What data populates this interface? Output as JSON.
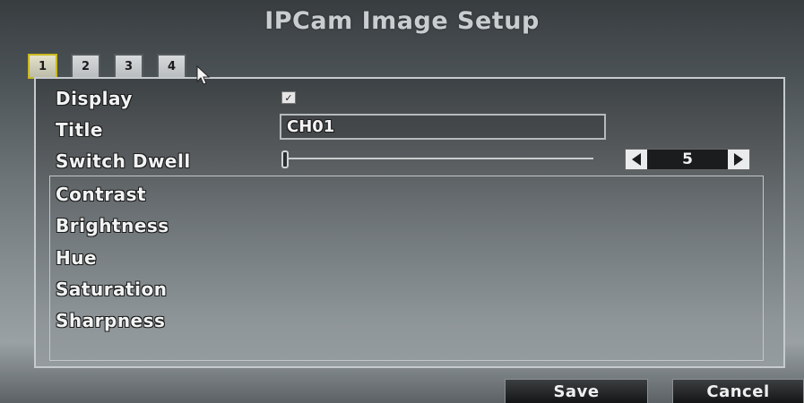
{
  "header": {
    "title": "IPCam Image Setup"
  },
  "tabs": [
    {
      "label": "1",
      "active": true
    },
    {
      "label": "2",
      "active": false
    },
    {
      "label": "3",
      "active": false
    },
    {
      "label": "4",
      "active": false
    }
  ],
  "fields": {
    "display_label": "Display",
    "display_checked": true,
    "display_check_glyph": "✓",
    "title_label": "Title",
    "title_value": "CH01",
    "switch_dwell_label": "Switch Dwell",
    "switch_dwell_value": "5"
  },
  "image_settings": {
    "contrast_label": "Contrast",
    "brightness_label": "Brightness",
    "hue_label": "Hue",
    "saturation_label": "Saturation",
    "sharpness_label": "Sharpness"
  },
  "buttons": {
    "save_label": "Save",
    "cancel_label": "Cancel"
  },
  "colors": {
    "active_tab_border": "#c9b91e",
    "panel_border": "#c6cbcd",
    "button_bg": "#141516"
  },
  "icons": {
    "cursor": "mouse-pointer-icon",
    "decrement": "arrow-left-icon",
    "increment": "arrow-right-icon"
  }
}
